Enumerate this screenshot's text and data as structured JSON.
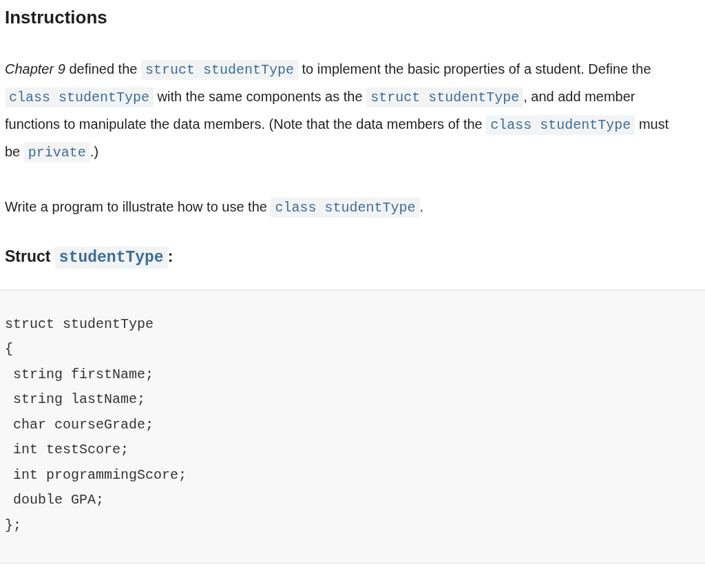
{
  "heading": "Instructions",
  "paragraphs": [
    [
      {
        "kind": "text",
        "text": "*Chapter 9* defined the"
      },
      {
        "kind": "code",
        "text": "struct studentType"
      },
      {
        "kind": "text",
        "text": "to implement the basic properties of a student. Define the"
      },
      {
        "kind": "code",
        "text": "class studentType"
      },
      {
        "kind": "text",
        "text": "with the same components as the"
      },
      {
        "kind": "code",
        "text": "struct studentType"
      },
      {
        "kind": "text",
        "text": ", and add member functions to manipulate the data members. (Note that the data members of the"
      },
      {
        "kind": "code",
        "text": "class studentType"
      },
      {
        "kind": "text",
        "text": "must be"
      },
      {
        "kind": "code",
        "text": "private"
      },
      {
        "kind": "text",
        "text": ".)"
      }
    ],
    [
      {
        "kind": "text",
        "text": "Write a program to illustrate how to use the"
      },
      {
        "kind": "code",
        "text": "class studentType"
      },
      {
        "kind": "text",
        "text": "."
      }
    ]
  ],
  "subheading": [
    {
      "kind": "text",
      "text": "Struct"
    },
    {
      "kind": "code",
      "text": "studentType"
    },
    {
      "kind": "text",
      "text": ":"
    }
  ],
  "code_lines": [
    "struct studentType",
    "{",
    " string firstName;",
    " string lastName;",
    " char courseGrade;",
    " int testScore;",
    " int programmingScore;",
    " double GPA;",
    "};"
  ]
}
